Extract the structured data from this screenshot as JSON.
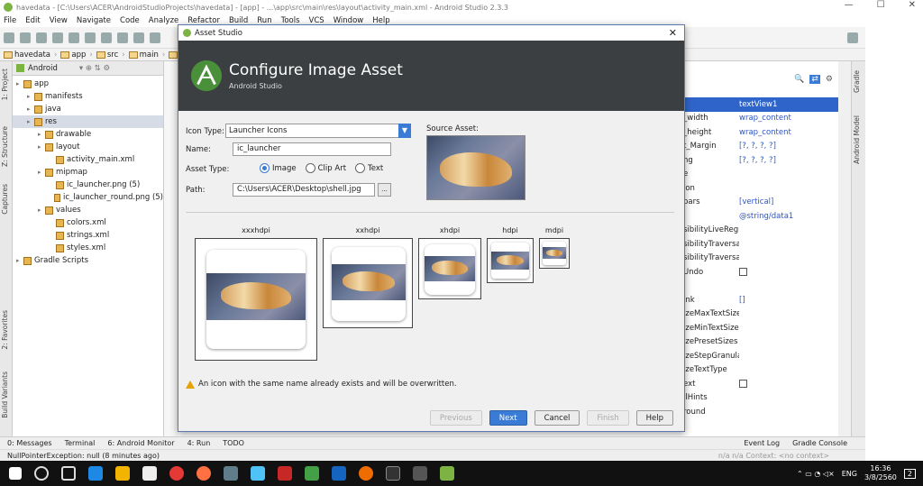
{
  "window": {
    "title": "havedata - [C:\\Users\\ACER\\AndroidStudioProjects\\havedata] - [app] - ...\\app\\src\\main\\res\\layout\\activity_main.xml - Android Studio 2.3.3"
  },
  "menu": [
    "File",
    "Edit",
    "View",
    "Navigate",
    "Code",
    "Analyze",
    "Refactor",
    "Build",
    "Run",
    "Tools",
    "VCS",
    "Window",
    "Help"
  ],
  "breadcrumbs": [
    "havedata",
    "app",
    "src",
    "main",
    "re"
  ],
  "left_tabs": [
    "1: Project",
    "Z: Structure",
    "Captures",
    "2: Favorites",
    "Build Variants"
  ],
  "project": {
    "view": "Android",
    "tree": [
      {
        "label": "app",
        "level": 0
      },
      {
        "label": "manifests",
        "level": 1
      },
      {
        "label": "java",
        "level": 1
      },
      {
        "label": "res",
        "level": 1
      },
      {
        "label": "drawable",
        "level": 2
      },
      {
        "label": "layout",
        "level": 2
      },
      {
        "label": "activity_main.xml",
        "level": 3
      },
      {
        "label": "mipmap",
        "level": 2
      },
      {
        "label": "ic_launcher.png (5)",
        "level": 3
      },
      {
        "label": "ic_launcher_round.png (5)",
        "level": 3
      },
      {
        "label": "values",
        "level": 2
      },
      {
        "label": "colors.xml",
        "level": 3
      },
      {
        "label": "strings.xml",
        "level": 3
      },
      {
        "label": "styles.xml",
        "level": 3
      },
      {
        "label": "Gradle Scripts",
        "level": 0
      }
    ]
  },
  "attributes": [
    {
      "name": "",
      "value": "textView1"
    },
    {
      "name": "_width",
      "value": "wrap_content"
    },
    {
      "name": "_height",
      "value": "wrap_content"
    },
    {
      "name": "t_Margin",
      "value": "[?, ?, ?, ?]"
    },
    {
      "name": "ng",
      "value": "[?, ?, ?, ?]"
    },
    {
      "name": "e",
      "value": ""
    },
    {
      "name": "ion",
      "value": ""
    },
    {
      "name": "bars",
      "value": "[vertical]"
    },
    {
      "name": "",
      "value": "@string/data1"
    },
    {
      "name": "sibilityLiveRegior",
      "value": ""
    },
    {
      "name": "sibilityTraversalA",
      "value": ""
    },
    {
      "name": "sibilityTraversalB",
      "value": ""
    },
    {
      "name": "Undo",
      "value": ""
    },
    {
      "name": "",
      "value": ""
    },
    {
      "name": "ink",
      "value": "[]"
    },
    {
      "name": "izeMaxTextSize",
      "value": ""
    },
    {
      "name": "izeMinTextSize",
      "value": ""
    },
    {
      "name": "izePresetSizes",
      "value": ""
    },
    {
      "name": "izeStepGranularit",
      "value": ""
    },
    {
      "name": "izeTextType",
      "value": ""
    },
    {
      "name": "ext",
      "value": ""
    },
    {
      "name": "llHints",
      "value": ""
    },
    {
      "name": "round",
      "value": ""
    }
  ],
  "right_tabs": [
    "Gradle",
    "Android Model"
  ],
  "dialog": {
    "title": "Asset Studio",
    "banner_title": "Configure Image Asset",
    "banner_subtitle": "Android Studio",
    "icon_type_label": "Icon Type:",
    "icon_type_value": "Launcher Icons",
    "name_label": "Name:",
    "name_value": "ic_launcher",
    "asset_type_label": "Asset Type:",
    "asset_types": [
      "Image",
      "Clip Art",
      "Text"
    ],
    "asset_type_selected": "Image",
    "path_label": "Path:",
    "path_value": "C:\\Users\\ACER\\Desktop\\shell.jpg",
    "browse_label": "...",
    "source_asset_label": "Source Asset:",
    "densities": [
      "xxxhdpi",
      "xxhdpi",
      "xhdpi",
      "hdpi",
      "mdpi"
    ],
    "warning": "An icon with the same name already exists and will be overwritten.",
    "buttons": {
      "previous": "Previous",
      "next": "Next",
      "cancel": "Cancel",
      "finish": "Finish",
      "help": "Help"
    }
  },
  "status": {
    "tools": [
      "0: Messages",
      "Terminal",
      "6: Android Monitor",
      "4: Run",
      "TODO"
    ],
    "right_tools": [
      "Event Log",
      "Gradle Console"
    ],
    "message": "NullPointerException: null (8 minutes ago)",
    "right_status": "n/a   n/a   Context: <no context>"
  },
  "taskbar": {
    "time": "16:36",
    "date": "3/8/2560",
    "lang": "ENG",
    "notifications": "2"
  },
  "colors": {
    "accent": "#3a7bd5",
    "banner": "#3c3f41",
    "selection": "#2f65ca"
  }
}
